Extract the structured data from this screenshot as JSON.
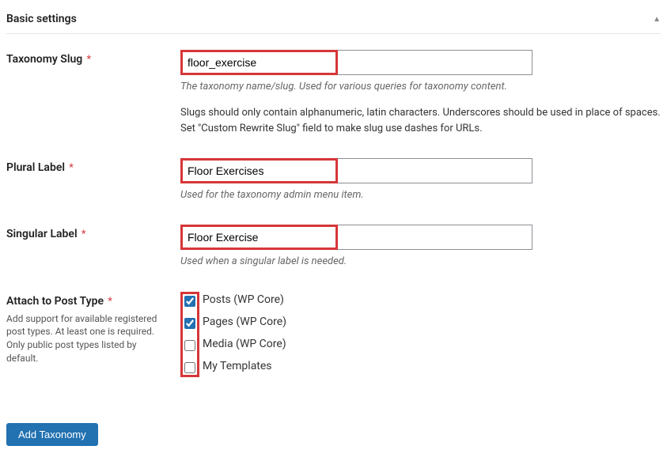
{
  "panel": {
    "title": "Basic settings"
  },
  "fields": {
    "slug": {
      "label": "Taxonomy Slug",
      "value": "floor_exercise",
      "description": "The taxonomy name/slug. Used for various queries for taxonomy content.",
      "extra": "Slugs should only contain alphanumeric, latin characters. Underscores should be used in place of spaces. Set \"Custom Rewrite Slug\" field to make slug use dashes for URLs."
    },
    "plural": {
      "label": "Plural Label",
      "value": "Floor Exercises",
      "description": "Used for the taxonomy admin menu item."
    },
    "singular": {
      "label": "Singular Label",
      "value": "Floor Exercise",
      "description": "Used when a singular label is needed."
    },
    "post_types": {
      "label": "Attach to Post Type",
      "help": "Add support for available registered post types. At least one is required. Only public post types listed by default.",
      "options": [
        {
          "label": "Posts (WP Core)",
          "checked": true
        },
        {
          "label": "Pages (WP Core)",
          "checked": true
        },
        {
          "label": "Media (WP Core)",
          "checked": false
        },
        {
          "label": "My Templates",
          "checked": false
        }
      ]
    }
  },
  "submit": {
    "label": "Add Taxonomy"
  },
  "asterisk": "*"
}
